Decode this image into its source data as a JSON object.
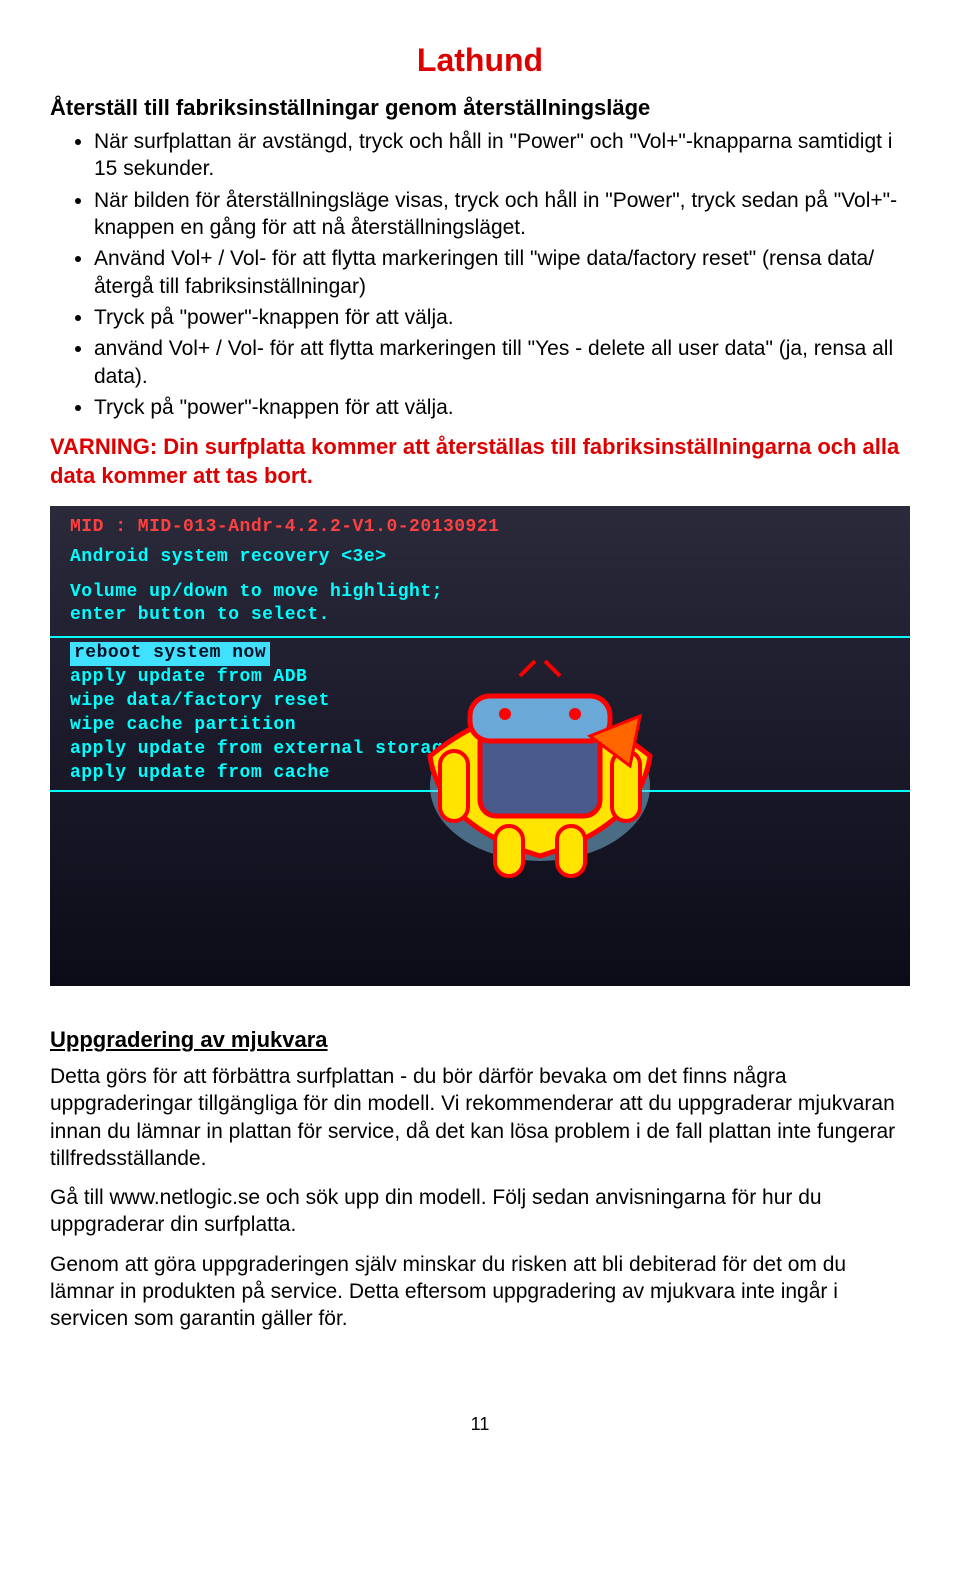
{
  "title": "Lathund",
  "section_heading": "Återställ till fabriksinställningar genom återställningsläge",
  "bullets": [
    "När surfplattan är avstängd, tryck och håll in \"Power\" och \"Vol+\"-knapparna samtidigt i 15 sekunder.",
    "När bilden för återställningsläge visas, tryck och håll in \"Power\", tryck sedan på \"Vol+\"-knappen en gång för att nå återställningsläget.",
    "Använd Vol+ / Vol- för att flytta markeringen till \"wipe data/factory reset\" (rensa data/återgå till fabriksinställningar)",
    "Tryck på \"power\"-knappen för att välja.",
    "använd Vol+ / Vol- för att flytta markeringen till \"Yes - delete all user data\" (ja, rensa all data).",
    "Tryck på \"power\"-knappen för att välja."
  ],
  "warning": "VARNING: Din surfplatta kommer att återställas till fabriksinställningarna och alla data kommer att tas bort.",
  "recovery_screen": {
    "line1": "MID : MID-013-Andr-4.2.2-V1.0-20130921",
    "line2": "Android system recovery <3e>",
    "line3": "Volume up/down to move highlight;",
    "line4": "enter button to select.",
    "opt1": "reboot system now",
    "opt2": "apply update from ADB",
    "opt3": "wipe data/factory reset",
    "opt4": "wipe cache partition",
    "opt5": "apply update from external storage",
    "opt6": "apply update from cache"
  },
  "upgrade_heading": "Uppgradering av mjukvara",
  "upgrade_p1": "Detta görs för att förbättra surfplattan - du bör därför bevaka om det finns några uppgraderingar tillgängliga för din modell. Vi rekommenderar att du uppgraderar mjukvaran innan du lämnar in plattan för service, då det kan lösa problem i de fall plattan inte fungerar tillfredsställande.",
  "upgrade_p2": "Gå till www.netlogic.se och sök upp din modell. Följ sedan anvisningarna för hur du uppgraderar din surfplatta.",
  "upgrade_p3": "Genom att göra uppgraderingen själv minskar du risken att bli debiterad för det om du lämnar in produkten på service. Detta eftersom uppgradering av mjukvara inte ingår i servicen som garantin gäller för.",
  "page_number": "11"
}
